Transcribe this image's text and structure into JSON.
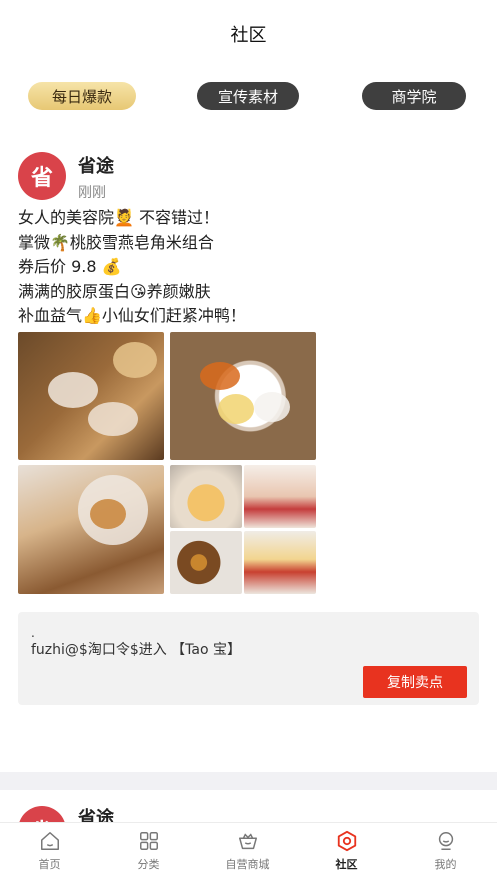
{
  "header": {
    "title": "社区"
  },
  "tabs": [
    {
      "label": "每日爆款",
      "active": true
    },
    {
      "label": "宣传素材",
      "active": false
    },
    {
      "label": "商学院",
      "active": false
    }
  ],
  "post": {
    "avatar_text": "省",
    "author": "省途",
    "time": "刚刚",
    "lines": [
      "女人的美容院💆 不容错过！",
      "掌微🌴桃胶雪燕皂角米组合",
      "券后价 9.8 💰",
      "满满的胶原蛋白😘养颜嫩肤",
      "补血益气👍小仙女们赶紧冲鸭！"
    ],
    "copy_box": {
      "dot": ".",
      "code": "fuzhi@$淘口令$进入 【Tao 宝】",
      "button": "复制卖点"
    }
  },
  "post2": {
    "avatar_text": "省",
    "author": "省途"
  },
  "tabbar": [
    {
      "label": "首页",
      "icon": "home-icon",
      "active": false
    },
    {
      "label": "分类",
      "icon": "grid-icon",
      "active": false
    },
    {
      "label": "自营商城",
      "icon": "crown-basket-icon",
      "active": false
    },
    {
      "label": "社区",
      "icon": "hexagon-icon",
      "active": true
    },
    {
      "label": "我的",
      "icon": "person-icon",
      "active": false
    }
  ],
  "colors": {
    "accent": "#e8331f",
    "active_tab_gold": "#e7c874",
    "avatar_red": "#d9434a"
  }
}
